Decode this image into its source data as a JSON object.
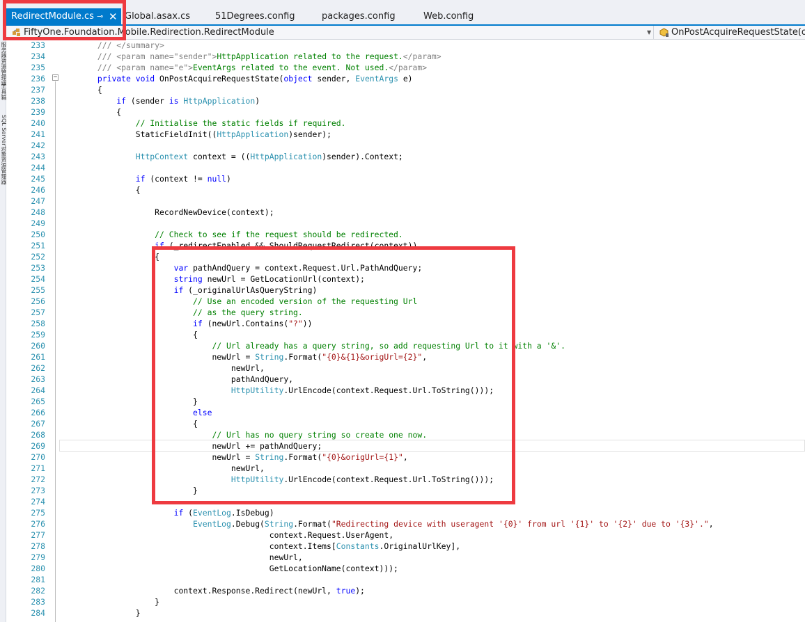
{
  "tabs": [
    {
      "label": "RedirectModule.cs",
      "active": true
    },
    {
      "label": "Global.asax.cs",
      "active": false
    },
    {
      "label": "51Degrees.config",
      "active": false
    },
    {
      "label": "packages.config",
      "active": false
    },
    {
      "label": "Web.config",
      "active": false
    }
  ],
  "tab_pin_icon": "⊸",
  "tab_close_icon": "✕",
  "nav": {
    "class_name": "FiftyOne.Foundation.Mobile.Redirection.RedirectModule",
    "member_name": "OnPostAcquireRequestState(object"
  },
  "left_strip": [
    "服务器资源管理器",
    "工具箱",
    "SQL Server对象资源管理器"
  ],
  "colors": {
    "accent": "#007acc",
    "annotation": "#ee3a40",
    "keyword": "#0000ff",
    "type": "#2b91af",
    "comment": "#008000",
    "string": "#a31515"
  },
  "code_lines": [
    {
      "n": "233",
      "ind": "        ",
      "t": [
        [
          "xml",
          "/// </summary>"
        ]
      ]
    },
    {
      "n": "234",
      "ind": "        ",
      "t": [
        [
          "xml",
          "/// <param name=\"sender\">"
        ],
        [
          "cm",
          "HttpApplication related to the request."
        ],
        [
          "xml",
          "</param>"
        ]
      ]
    },
    {
      "n": "235",
      "ind": "        ",
      "t": [
        [
          "xml",
          "/// <param name=\"e\">"
        ],
        [
          "cm",
          "EventArgs related to the event. Not used."
        ],
        [
          "xml",
          "</param>"
        ]
      ]
    },
    {
      "n": "236",
      "ind": "        ",
      "t": [
        [
          "kw",
          "private void "
        ],
        [
          "",
          "OnPostAcquireRequestState("
        ],
        [
          "kw",
          "object "
        ],
        [
          "",
          "sender, "
        ],
        [
          "ty",
          "EventArgs "
        ],
        [
          "",
          "e)"
        ]
      ]
    },
    {
      "n": "237",
      "ind": "        ",
      "t": [
        [
          "",
          "{"
        ]
      ]
    },
    {
      "n": "238",
      "ind": "            ",
      "t": [
        [
          "kw",
          "if "
        ],
        [
          "",
          "(sender "
        ],
        [
          "kw",
          "is "
        ],
        [
          "ty",
          "HttpApplication"
        ],
        [
          "",
          ")"
        ]
      ]
    },
    {
      "n": "239",
      "ind": "            ",
      "t": [
        [
          "",
          "{"
        ]
      ]
    },
    {
      "n": "240",
      "ind": "                ",
      "t": [
        [
          "cm",
          "// Initialise the static fields if required."
        ]
      ]
    },
    {
      "n": "241",
      "ind": "                ",
      "t": [
        [
          "",
          "StaticFieldInit(("
        ],
        [
          "ty",
          "HttpApplication"
        ],
        [
          "",
          ")sender);"
        ]
      ]
    },
    {
      "n": "242",
      "ind": "",
      "t": []
    },
    {
      "n": "243",
      "ind": "                ",
      "t": [
        [
          "ty",
          "HttpContext "
        ],
        [
          "",
          "context = (("
        ],
        [
          "ty",
          "HttpApplication"
        ],
        [
          "",
          ")sender).Context;"
        ]
      ]
    },
    {
      "n": "244",
      "ind": "",
      "t": []
    },
    {
      "n": "245",
      "ind": "                ",
      "t": [
        [
          "kw",
          "if "
        ],
        [
          "",
          "(context != "
        ],
        [
          "kw",
          "null"
        ],
        [
          "",
          ")"
        ]
      ]
    },
    {
      "n": "246",
      "ind": "                ",
      "t": [
        [
          "",
          "{"
        ]
      ]
    },
    {
      "n": "247",
      "ind": "",
      "t": []
    },
    {
      "n": "248",
      "ind": "                    ",
      "t": [
        [
          "",
          "RecordNewDevice(context);"
        ]
      ]
    },
    {
      "n": "249",
      "ind": "",
      "t": []
    },
    {
      "n": "250",
      "ind": "                    ",
      "t": [
        [
          "cm",
          "// Check to see if the request should be redirected."
        ]
      ]
    },
    {
      "n": "251",
      "ind": "                    ",
      "t": [
        [
          "kw",
          "if "
        ],
        [
          "",
          "(_redirectEnabled && ShouldRequestRedirect(context))"
        ]
      ]
    },
    {
      "n": "252",
      "ind": "                    ",
      "t": [
        [
          "",
          "{"
        ]
      ]
    },
    {
      "n": "253",
      "ind": "                        ",
      "t": [
        [
          "kw",
          "var "
        ],
        [
          "",
          "pathAndQuery = context.Request.Url.PathAndQuery;"
        ]
      ]
    },
    {
      "n": "254",
      "ind": "                        ",
      "t": [
        [
          "kw",
          "string "
        ],
        [
          "",
          "newUrl = GetLocationUrl(context);"
        ]
      ]
    },
    {
      "n": "255",
      "ind": "                        ",
      "t": [
        [
          "kw",
          "if "
        ],
        [
          "",
          "(_originalUrlAsQueryString)"
        ]
      ]
    },
    {
      "n": "256",
      "ind": "                            ",
      "t": [
        [
          "cm",
          "// Use an encoded version of the requesting Url"
        ]
      ]
    },
    {
      "n": "257",
      "ind": "                            ",
      "t": [
        [
          "cm",
          "// as the query string."
        ]
      ]
    },
    {
      "n": "258",
      "ind": "                            ",
      "t": [
        [
          "kw",
          "if "
        ],
        [
          "",
          "(newUrl.Contains("
        ],
        [
          "st",
          "\"?\""
        ],
        [
          "",
          "))"
        ]
      ]
    },
    {
      "n": "259",
      "ind": "                            ",
      "t": [
        [
          "",
          "{"
        ]
      ]
    },
    {
      "n": "260",
      "ind": "                                ",
      "t": [
        [
          "cm",
          "// Url already has a query string, so add requesting Url to it with a '&'."
        ]
      ]
    },
    {
      "n": "261",
      "ind": "                                ",
      "t": [
        [
          "",
          "newUrl = "
        ],
        [
          "ty",
          "String"
        ],
        [
          "",
          ".Format("
        ],
        [
          "st",
          "\"{0}&{1}&origUrl={2}\""
        ],
        [
          "",
          ","
        ]
      ]
    },
    {
      "n": "262",
      "ind": "                                    ",
      "t": [
        [
          "",
          "newUrl,"
        ]
      ]
    },
    {
      "n": "263",
      "ind": "                                    ",
      "t": [
        [
          "",
          "pathAndQuery,"
        ]
      ]
    },
    {
      "n": "264",
      "ind": "                                    ",
      "t": [
        [
          "ty",
          "HttpUtility"
        ],
        [
          "",
          ".UrlEncode(context.Request.Url.ToString()));"
        ]
      ]
    },
    {
      "n": "265",
      "ind": "                            ",
      "t": [
        [
          "",
          "}"
        ]
      ]
    },
    {
      "n": "266",
      "ind": "                            ",
      "t": [
        [
          "kw",
          "else"
        ]
      ]
    },
    {
      "n": "267",
      "ind": "                            ",
      "t": [
        [
          "",
          "{"
        ]
      ]
    },
    {
      "n": "268",
      "ind": "                                ",
      "t": [
        [
          "cm",
          "// Url has no query string so create one now."
        ]
      ]
    },
    {
      "n": "269",
      "ind": "                                ",
      "t": [
        [
          "",
          "newUrl += pathAndQuery;"
        ]
      ]
    },
    {
      "n": "270",
      "ind": "                                ",
      "t": [
        [
          "",
          "newUrl = "
        ],
        [
          "ty",
          "String"
        ],
        [
          "",
          ".Format("
        ],
        [
          "st",
          "\"{0}&origUrl={1}\""
        ],
        [
          "",
          ","
        ]
      ]
    },
    {
      "n": "271",
      "ind": "                                    ",
      "t": [
        [
          "",
          "newUrl,"
        ]
      ]
    },
    {
      "n": "272",
      "ind": "                                    ",
      "t": [
        [
          "ty",
          "HttpUtility"
        ],
        [
          "",
          ".UrlEncode(context.Request.Url.ToString()));"
        ]
      ]
    },
    {
      "n": "273",
      "ind": "                            ",
      "t": [
        [
          "",
          "}"
        ]
      ]
    },
    {
      "n": "274",
      "ind": "",
      "t": []
    },
    {
      "n": "275",
      "ind": "                        ",
      "t": [
        [
          "kw",
          "if "
        ],
        [
          "",
          "("
        ],
        [
          "ty",
          "EventLog"
        ],
        [
          "",
          ".IsDebug)"
        ]
      ]
    },
    {
      "n": "276",
      "ind": "                            ",
      "t": [
        [
          "ty",
          "EventLog"
        ],
        [
          "",
          ".Debug("
        ],
        [
          "ty",
          "String"
        ],
        [
          "",
          ".Format("
        ],
        [
          "st",
          "\"Redirecting device with useragent '{0}' from url '{1}' to '{2}' due to '{3}'.\""
        ],
        [
          "",
          ","
        ]
      ]
    },
    {
      "n": "277",
      "ind": "                                            ",
      "t": [
        [
          "",
          "context.Request.UserAgent,"
        ]
      ]
    },
    {
      "n": "278",
      "ind": "                                            ",
      "t": [
        [
          "",
          "context.Items["
        ],
        [
          "ty",
          "Constants"
        ],
        [
          "",
          ".OriginalUrlKey],"
        ]
      ]
    },
    {
      "n": "279",
      "ind": "                                            ",
      "t": [
        [
          "",
          "newUrl,"
        ]
      ]
    },
    {
      "n": "280",
      "ind": "                                            ",
      "t": [
        [
          "",
          "GetLocationName(context)));"
        ]
      ]
    },
    {
      "n": "281",
      "ind": "",
      "t": []
    },
    {
      "n": "282",
      "ind": "                        ",
      "t": [
        [
          "",
          "context.Response.Redirect(newUrl, "
        ],
        [
          "kw",
          "true"
        ],
        [
          "",
          ");"
        ]
      ]
    },
    {
      "n": "283",
      "ind": "                    ",
      "t": [
        [
          "",
          "}"
        ]
      ]
    },
    {
      "n": "284",
      "ind": "                ",
      "t": [
        [
          "",
          "}"
        ]
      ]
    }
  ]
}
